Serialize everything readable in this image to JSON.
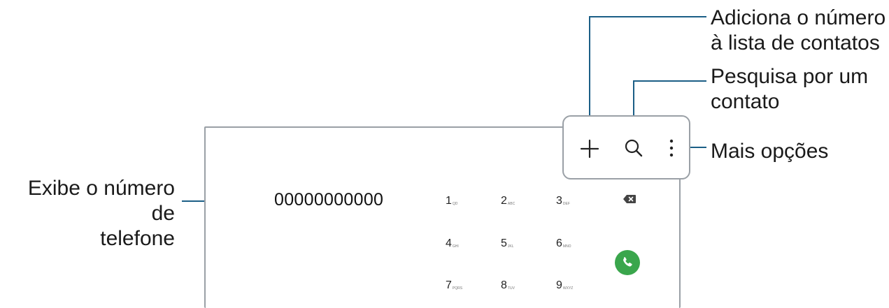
{
  "callouts": {
    "add_contact": "Adiciona o número\nà lista de contatos",
    "search": "Pesquisa por um\ncontato",
    "more_options": "Mais opções",
    "display_number": "Exibe o número de\ntelefone"
  },
  "dialer": {
    "number": "00000000000",
    "keys": [
      {
        "digit": "1",
        "letters": "QD"
      },
      {
        "digit": "2",
        "letters": "ABC"
      },
      {
        "digit": "3",
        "letters": "DEF"
      },
      {
        "digit": "4",
        "letters": "GHI"
      },
      {
        "digit": "5",
        "letters": "JKL"
      },
      {
        "digit": "6",
        "letters": "MNO"
      },
      {
        "digit": "7",
        "letters": "PQRS"
      },
      {
        "digit": "8",
        "letters": "TUV"
      },
      {
        "digit": "9",
        "letters": "WXYZ"
      }
    ]
  },
  "colors": {
    "callout_line": "#1b5e86",
    "call_button": "#3aa64c"
  },
  "icons": {
    "add": "plus-icon",
    "search": "search-icon",
    "more": "more-options-icon",
    "backspace": "backspace-icon",
    "call": "phone-icon"
  }
}
